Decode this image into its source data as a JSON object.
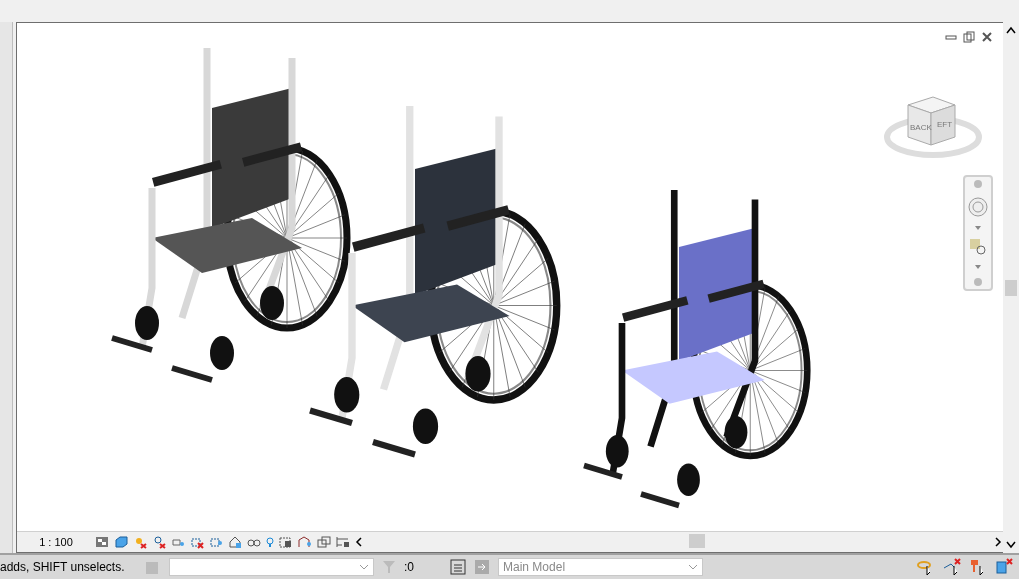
{
  "view_cube": {
    "faces": [
      "BACK",
      "EFT"
    ]
  },
  "view_bar": {
    "scale": "1 : 100"
  },
  "status_bar": {
    "message": "adds, SHIFT unselects.",
    "count": ":0",
    "model": "Main Model"
  }
}
